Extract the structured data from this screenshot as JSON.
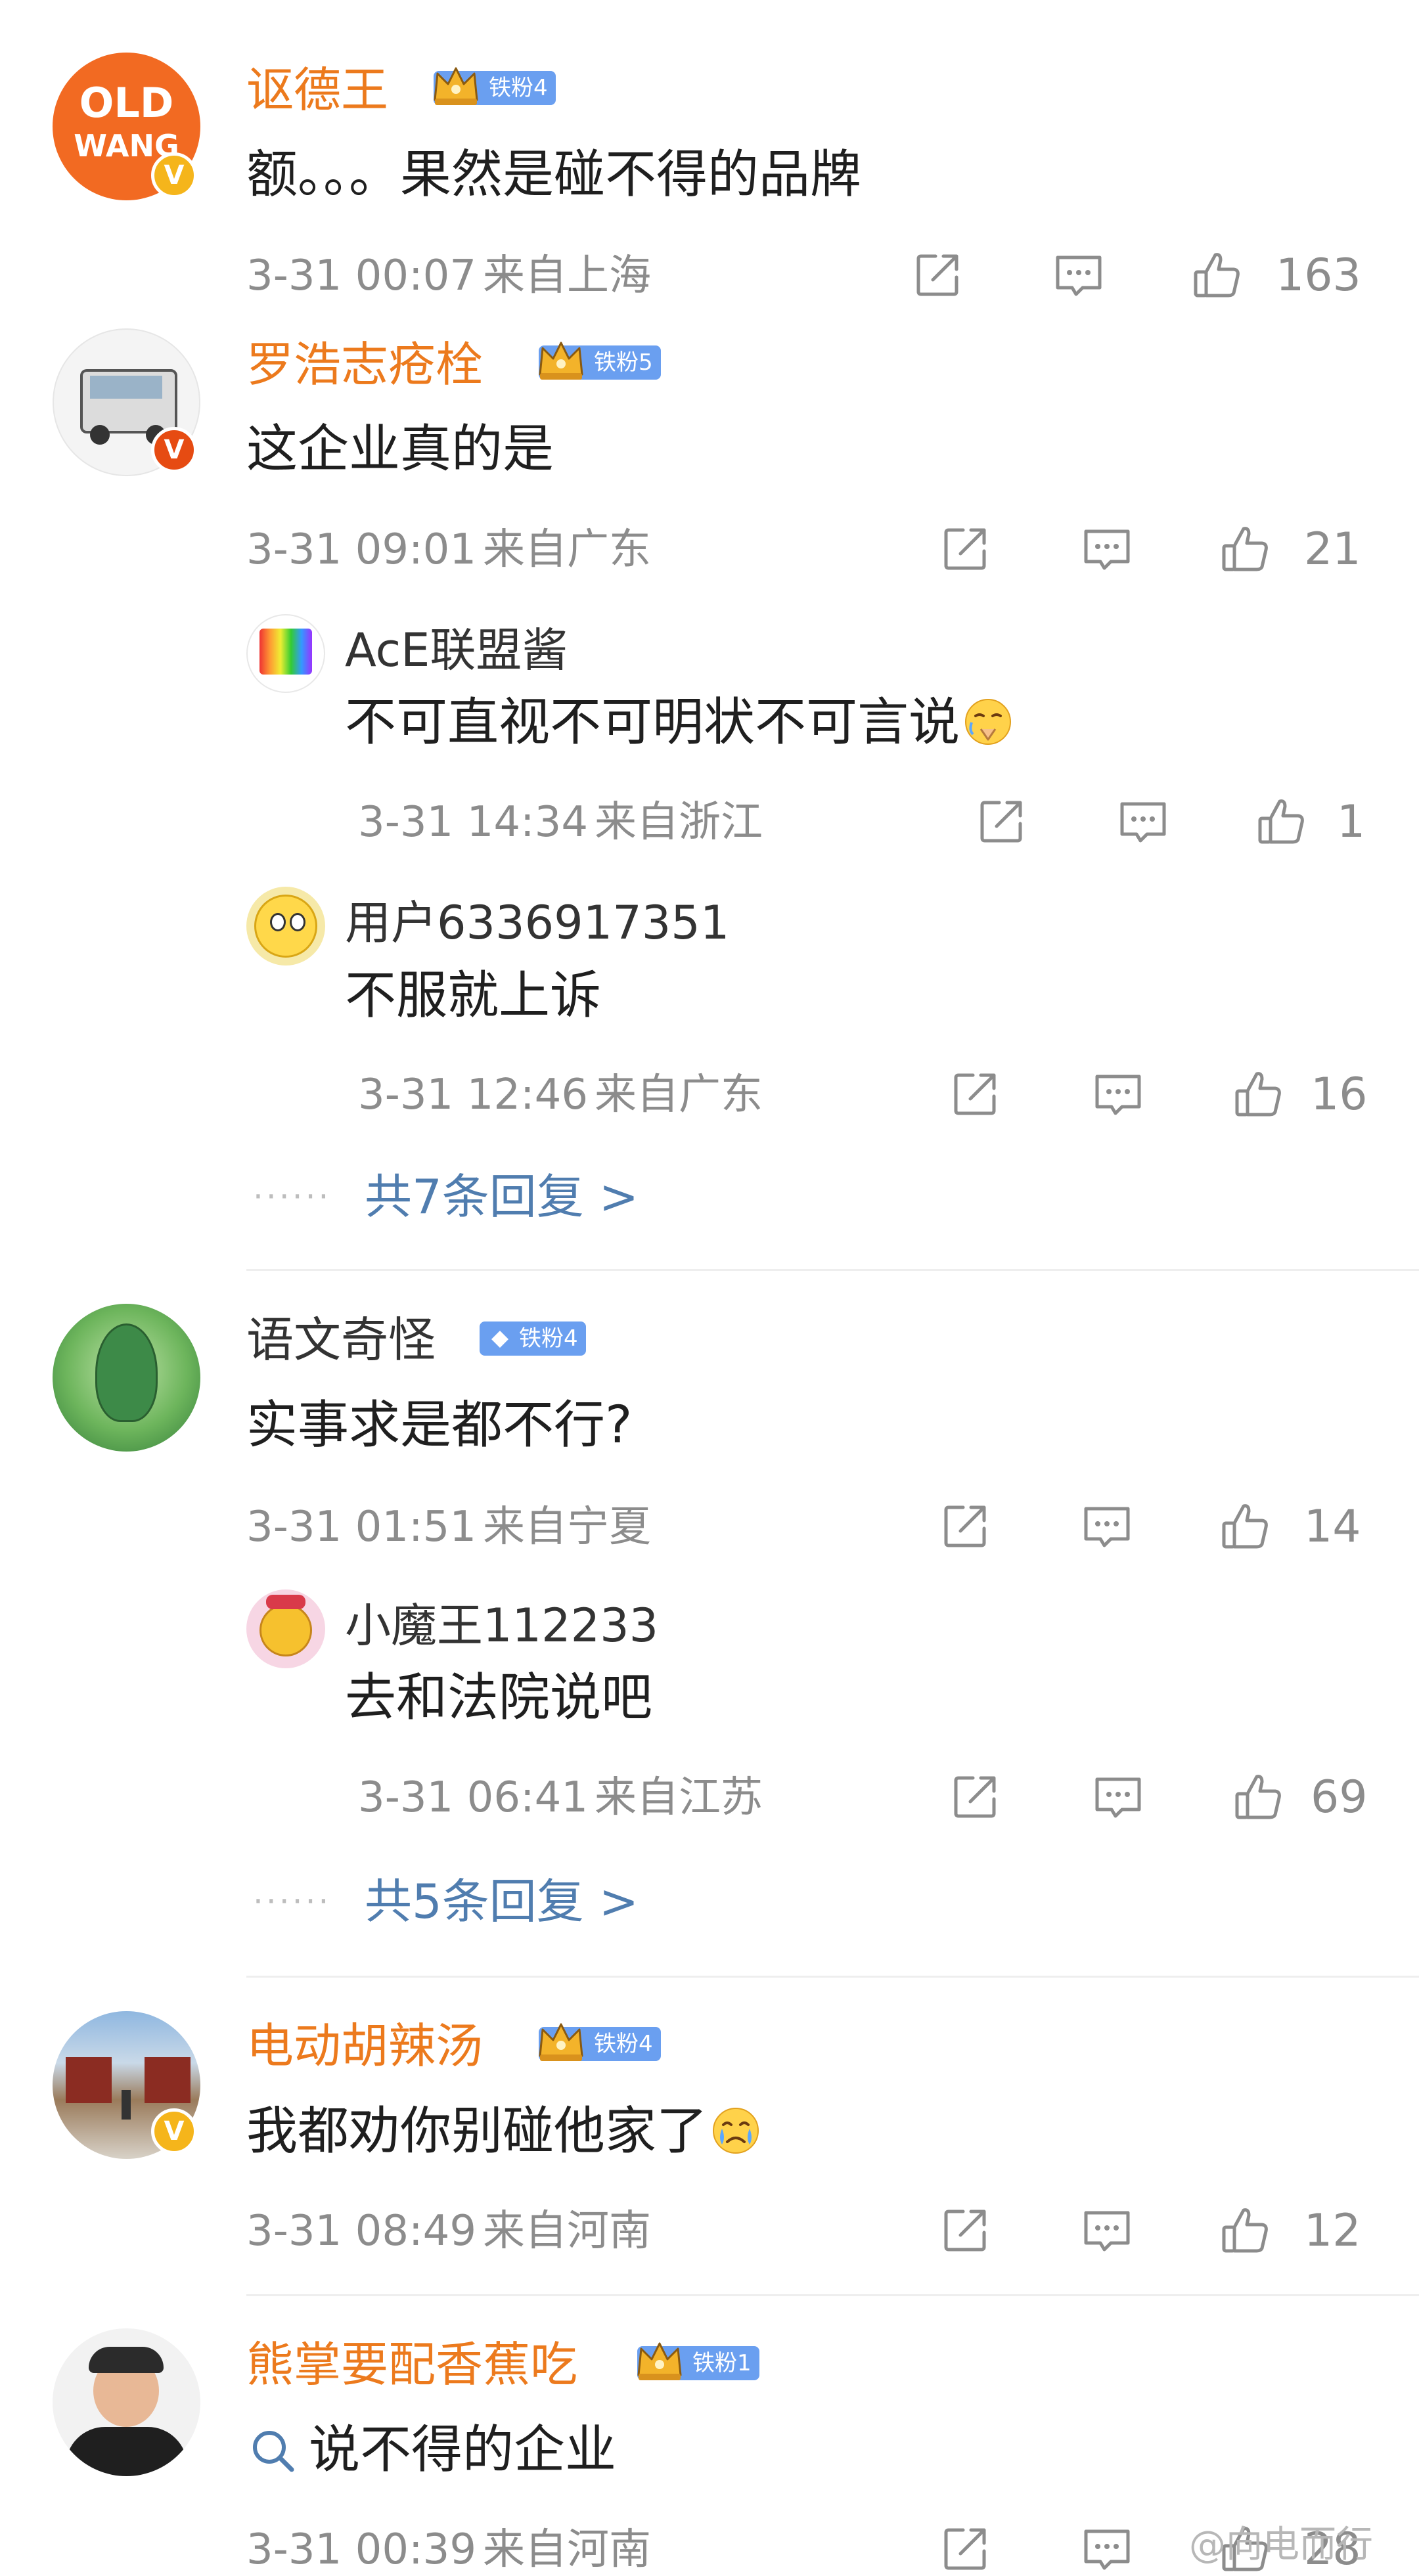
{
  "comments": [
    {
      "name": "讴德王",
      "fan_badge": "铁粉4",
      "text": "额。。。果然是碰不得的品牌",
      "time": "3-31 00:07",
      "location": "来自上海",
      "likes": "163",
      "avatar_text_top": "OLD",
      "avatar_text_bottom": "WANG",
      "verified": "V"
    },
    {
      "name": "罗浩志疮栓",
      "fan_badge": "铁粉5",
      "text": "这企业真的是",
      "time": "3-31 09:01",
      "location": "来自广东",
      "likes": "21",
      "verified": "V",
      "replies": [
        {
          "name": "AcE联盟酱",
          "text": "不可直视不可明状不可言说",
          "time": "3-31 14:34",
          "location": "来自浙江",
          "likes": "1"
        },
        {
          "name": "用户6336917351",
          "text": "不服就上诉",
          "time": "3-31 12:46",
          "location": "来自广东",
          "likes": "16"
        }
      ],
      "more_replies": "共7条回复 >"
    },
    {
      "name": "语文奇怪",
      "fan_badge": "铁粉4",
      "text": "实事求是都不行?",
      "time": "3-31 01:51",
      "location": "来自宁夏",
      "likes": "14",
      "replies": [
        {
          "name": "小魔王112233",
          "text": "去和法院说吧",
          "time": "3-31 06:41",
          "location": "来自江苏",
          "likes": "69"
        }
      ],
      "more_replies": "共5条回复 >"
    },
    {
      "name": "电动胡辣汤",
      "fan_badge": "铁粉4",
      "text": "我都劝你别碰他家了",
      "time": "3-31 08:49",
      "location": "来自河南",
      "likes": "12",
      "verified": "V"
    },
    {
      "name": "熊掌要配香蕉吃",
      "fan_badge": "铁粉1",
      "text": "说不得的企业",
      "time": "3-31 00:39",
      "location": "来自河南",
      "likes": "28"
    }
  ],
  "dots": "······",
  "watermark": "@向电而行",
  "colors": {
    "name_orange": "#ec7a1d",
    "link_blue": "#507daf",
    "meta_gray": "#8c8c8c",
    "fan_badge": "#6a9ff0"
  },
  "icons": {
    "share": "share-icon",
    "comment": "comment-icon",
    "like": "like-icon",
    "search": "search-icon"
  }
}
